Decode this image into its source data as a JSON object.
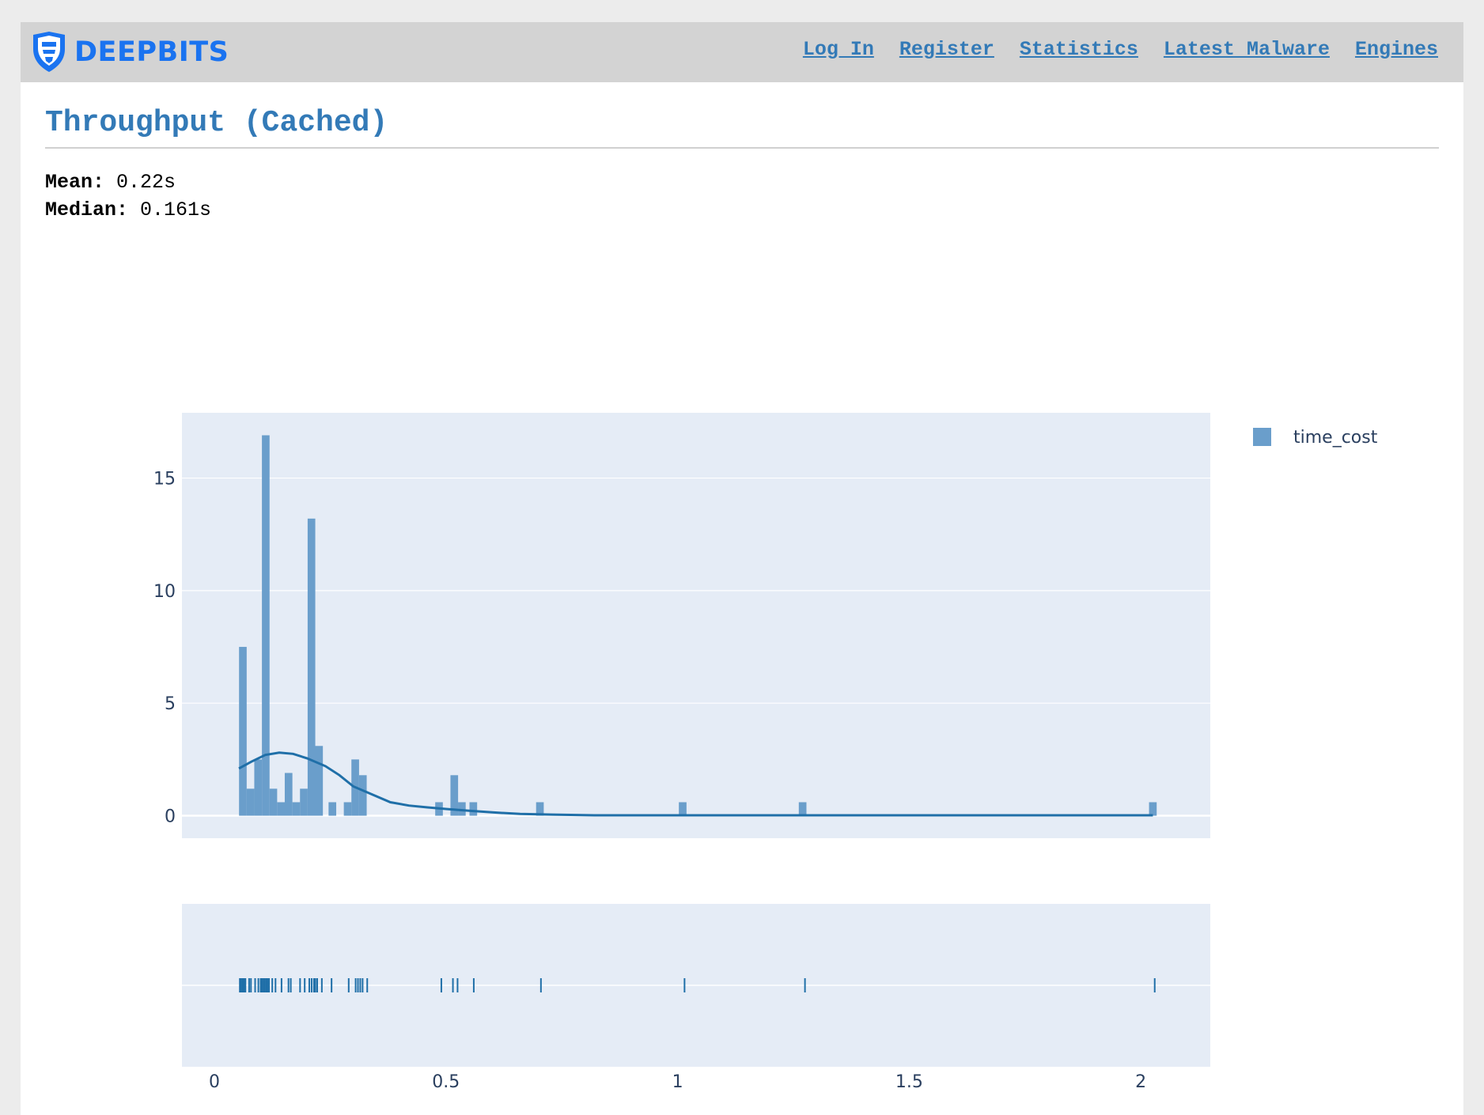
{
  "brand": {
    "name": "DEEPBITS"
  },
  "nav": {
    "links": [
      "Log In",
      "Register",
      "Statistics",
      "Latest Malware",
      "Engines"
    ]
  },
  "page": {
    "title": "Throughput (Cached)"
  },
  "stats": {
    "mean_label": "Mean:",
    "mean_value": "0.22s",
    "median_label": "Median:",
    "median_value": "0.161s"
  },
  "chart_data": {
    "type": "histogram",
    "series": [
      {
        "name": "time_cost",
        "kind": "bar"
      },
      {
        "name": "",
        "kind": "line"
      },
      {
        "name": "",
        "kind": "rug"
      }
    ],
    "x_ticks": [
      "0",
      "0.5",
      "1",
      "1.5",
      "2"
    ],
    "y_ticks": [
      "0",
      "5",
      "10",
      "15"
    ],
    "xlim": [
      -0.07,
      2.15
    ],
    "ylim": [
      -1,
      17.9
    ],
    "bin_width": 0.0165,
    "bars": [
      {
        "x": 0.0615,
        "y": 7.5
      },
      {
        "x": 0.0779,
        "y": 1.2
      },
      {
        "x": 0.0944,
        "y": 2.5
      },
      {
        "x": 0.1109,
        "y": 16.9
      },
      {
        "x": 0.1273,
        "y": 1.2
      },
      {
        "x": 0.1438,
        "y": 0.6
      },
      {
        "x": 0.1602,
        "y": 1.9
      },
      {
        "x": 0.1767,
        "y": 0.6
      },
      {
        "x": 0.1931,
        "y": 1.2
      },
      {
        "x": 0.2096,
        "y": 13.2
      },
      {
        "x": 0.226,
        "y": 3.1
      },
      {
        "x": 0.2548,
        "y": 0.6
      },
      {
        "x": 0.2877,
        "y": 0.6
      },
      {
        "x": 0.3041,
        "y": 2.5
      },
      {
        "x": 0.3206,
        "y": 1.8
      },
      {
        "x": 0.485,
        "y": 0.6
      },
      {
        "x": 0.5179,
        "y": 1.8
      },
      {
        "x": 0.5343,
        "y": 0.6
      },
      {
        "x": 0.559,
        "y": 0.6
      },
      {
        "x": 0.7028,
        "y": 0.6
      },
      {
        "x": 1.011,
        "y": 0.6
      },
      {
        "x": 1.2699,
        "y": 0.6
      },
      {
        "x": 2.026,
        "y": 0.6
      }
    ],
    "kde": [
      [
        0.053,
        2.1
      ],
      [
        0.08,
        2.4
      ],
      [
        0.11,
        2.7
      ],
      [
        0.14,
        2.8
      ],
      [
        0.17,
        2.75
      ],
      [
        0.2,
        2.55
      ],
      [
        0.24,
        2.2
      ],
      [
        0.27,
        1.8
      ],
      [
        0.3,
        1.3
      ],
      [
        0.34,
        0.95
      ],
      [
        0.38,
        0.6
      ],
      [
        0.42,
        0.45
      ],
      [
        0.46,
        0.37
      ],
      [
        0.5,
        0.3
      ],
      [
        0.55,
        0.22
      ],
      [
        0.6,
        0.15
      ],
      [
        0.66,
        0.08
      ],
      [
        0.73,
        0.05
      ],
      [
        0.82,
        0.02
      ],
      [
        1.0,
        0.02
      ],
      [
        1.5,
        0.02
      ],
      [
        2.026,
        0.02
      ]
    ],
    "rug": [
      0.055,
      0.058,
      0.061,
      0.064,
      0.067,
      0.075,
      0.079,
      0.088,
      0.095,
      0.1,
      0.103,
      0.106,
      0.109,
      0.112,
      0.115,
      0.118,
      0.125,
      0.132,
      0.145,
      0.16,
      0.165,
      0.185,
      0.195,
      0.205,
      0.21,
      0.215,
      0.218,
      0.222,
      0.232,
      0.253,
      0.29,
      0.305,
      0.31,
      0.315,
      0.32,
      0.33,
      0.49,
      0.515,
      0.525,
      0.56,
      0.705,
      1.015,
      1.275,
      2.03
    ],
    "colors": {
      "bar": "#6a9ecb",
      "line": "#1f6fa8",
      "rug": "#1f6fa8",
      "plot_bg": "#e5ecf6",
      "grid": "#ffffff",
      "text": "#2a3f5f"
    },
    "legend_position": "top-right",
    "grid": true
  }
}
